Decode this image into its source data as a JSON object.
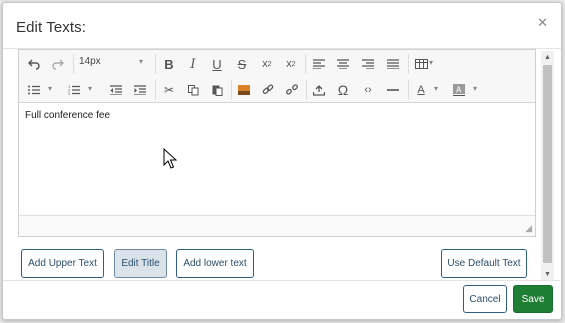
{
  "dialog": {
    "title": "Edit Texts:",
    "close_icon": "close-icon"
  },
  "toolbar": {
    "font_size": "14px",
    "row1_icons": [
      "undo-icon",
      "redo-icon",
      "bold-icon",
      "italic-icon",
      "underline-icon",
      "strikethrough-icon",
      "subscript-icon",
      "superscript-icon",
      "align-left-icon",
      "align-center-icon",
      "align-right-icon",
      "align-justify-icon",
      "table-icon"
    ],
    "row2_icons": [
      "unordered-list-icon",
      "ordered-list-icon",
      "outdent-icon",
      "indent-icon",
      "cut-icon",
      "copy-icon",
      "paste-icon",
      "image-icon",
      "link-icon",
      "unlink-icon",
      "upload-icon",
      "special-char-icon",
      "code-icon",
      "horizontal-rule-icon",
      "font-color-icon",
      "background-color-icon"
    ]
  },
  "editor": {
    "content": "Full conference fee"
  },
  "buttons": {
    "add_upper": "Add Upper Text",
    "edit_title": "Edit Title",
    "add_lower": "Add lower text",
    "use_default": "Use Default Text"
  },
  "footer": {
    "cancel": "Cancel",
    "save": "Save"
  },
  "colors": {
    "save_bg": "#1e7e34",
    "button_border": "#2e5f82",
    "active_button_bg": "#dbe3ea"
  }
}
